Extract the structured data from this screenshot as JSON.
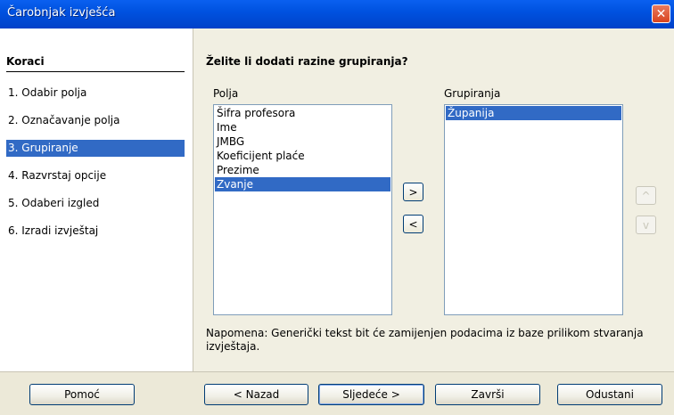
{
  "window": {
    "title": "Čarobnjak izvješća",
    "close_glyph": "✕"
  },
  "steps": {
    "title": "Koraci",
    "items": [
      {
        "label": "1.  Odabir polja"
      },
      {
        "label": "2.  Označavanje polja"
      },
      {
        "label": "3.  Grupiranje"
      },
      {
        "label": "4.  Razvrstaj opcije"
      },
      {
        "label": "5.  Odaberi izgled"
      },
      {
        "label": "6.  Izradi izvještaj"
      }
    ],
    "active_index": 2
  },
  "main": {
    "heading": "Želite li dodati razine grupiranja?",
    "fields_label": "Polja",
    "fields": [
      "Šifra profesora",
      "Ime",
      "JMBG",
      "Koeficijent plaće",
      "Prezime",
      "Zvanje"
    ],
    "fields_selected_index": 5,
    "groupings_label": "Grupiranja",
    "groupings": [
      "Županija"
    ],
    "groupings_selected_index": 0,
    "add_button": ">",
    "remove_button": "<",
    "up_button": "^",
    "down_button": "v",
    "note": "Napomena: Generički tekst bit će zamijenjen podacima iz baze prilikom stvaranja izvještaja."
  },
  "footer": {
    "help": "Pomoć",
    "back": "< Nazad",
    "next": "Sljedeće >",
    "finish": "Završi",
    "cancel": "Odustani"
  }
}
